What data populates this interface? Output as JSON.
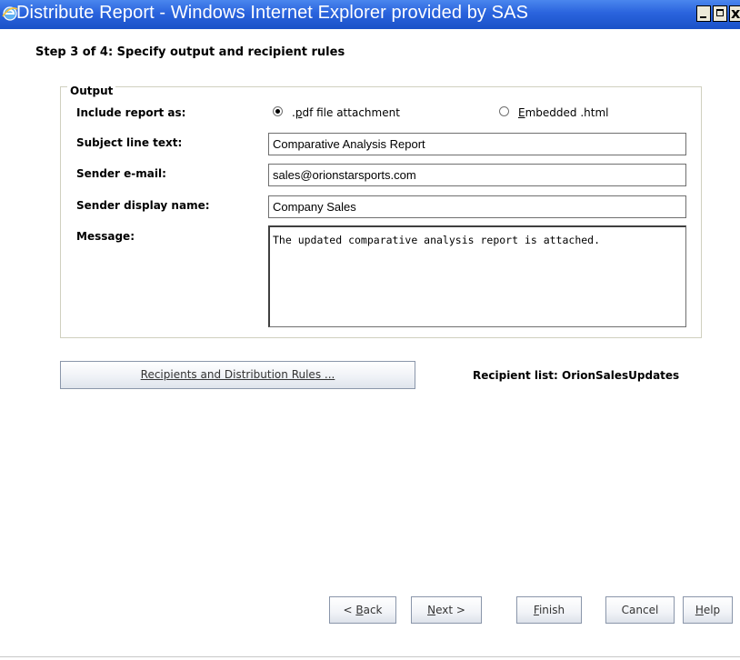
{
  "window": {
    "title": "Distribute Report - Windows Internet Explorer provided by SAS"
  },
  "step_heading": "Step 3 of 4: Specify output and recipient rules",
  "output": {
    "legend": "Output",
    "include_report_label": "Include report as:",
    "options": [
      {
        "label_underlined": "p",
        "label_rest": "df file attachment",
        "label_prefix": ".",
        "selected": true
      },
      {
        "label_underlined": "E",
        "label_rest": "mbedded .html",
        "label_prefix": "",
        "selected": false
      }
    ],
    "subject_label": "Subject line text:",
    "subject_value": "Comparative Analysis Report",
    "sender_email_label": "Sender e-mail:",
    "sender_email_value": "sales@orionstarsports.com",
    "sender_name_label": "Sender display name:",
    "sender_name_value": "Company Sales",
    "message_label": "Message:",
    "message_value": "The updated comparative analysis report is attached."
  },
  "recipients_button_label": "Recipients and Distribution Rules ...",
  "recipient_list_text": "Recipient list: OrionSalesUpdates",
  "buttons": {
    "back": {
      "prefix": "< ",
      "underlined": "B",
      "rest": "ack"
    },
    "next": {
      "prefix": "",
      "underlined": "N",
      "rest": "ext >"
    },
    "finish": {
      "prefix": "",
      "underlined": "F",
      "rest": "inish"
    },
    "cancel": {
      "prefix": "",
      "underlined": "",
      "rest": "Cancel"
    },
    "help": {
      "prefix": "",
      "underlined": "H",
      "rest": "elp"
    }
  },
  "colors": {
    "titlebar": "#2a63dd",
    "dialog_background": "#ffffff"
  }
}
